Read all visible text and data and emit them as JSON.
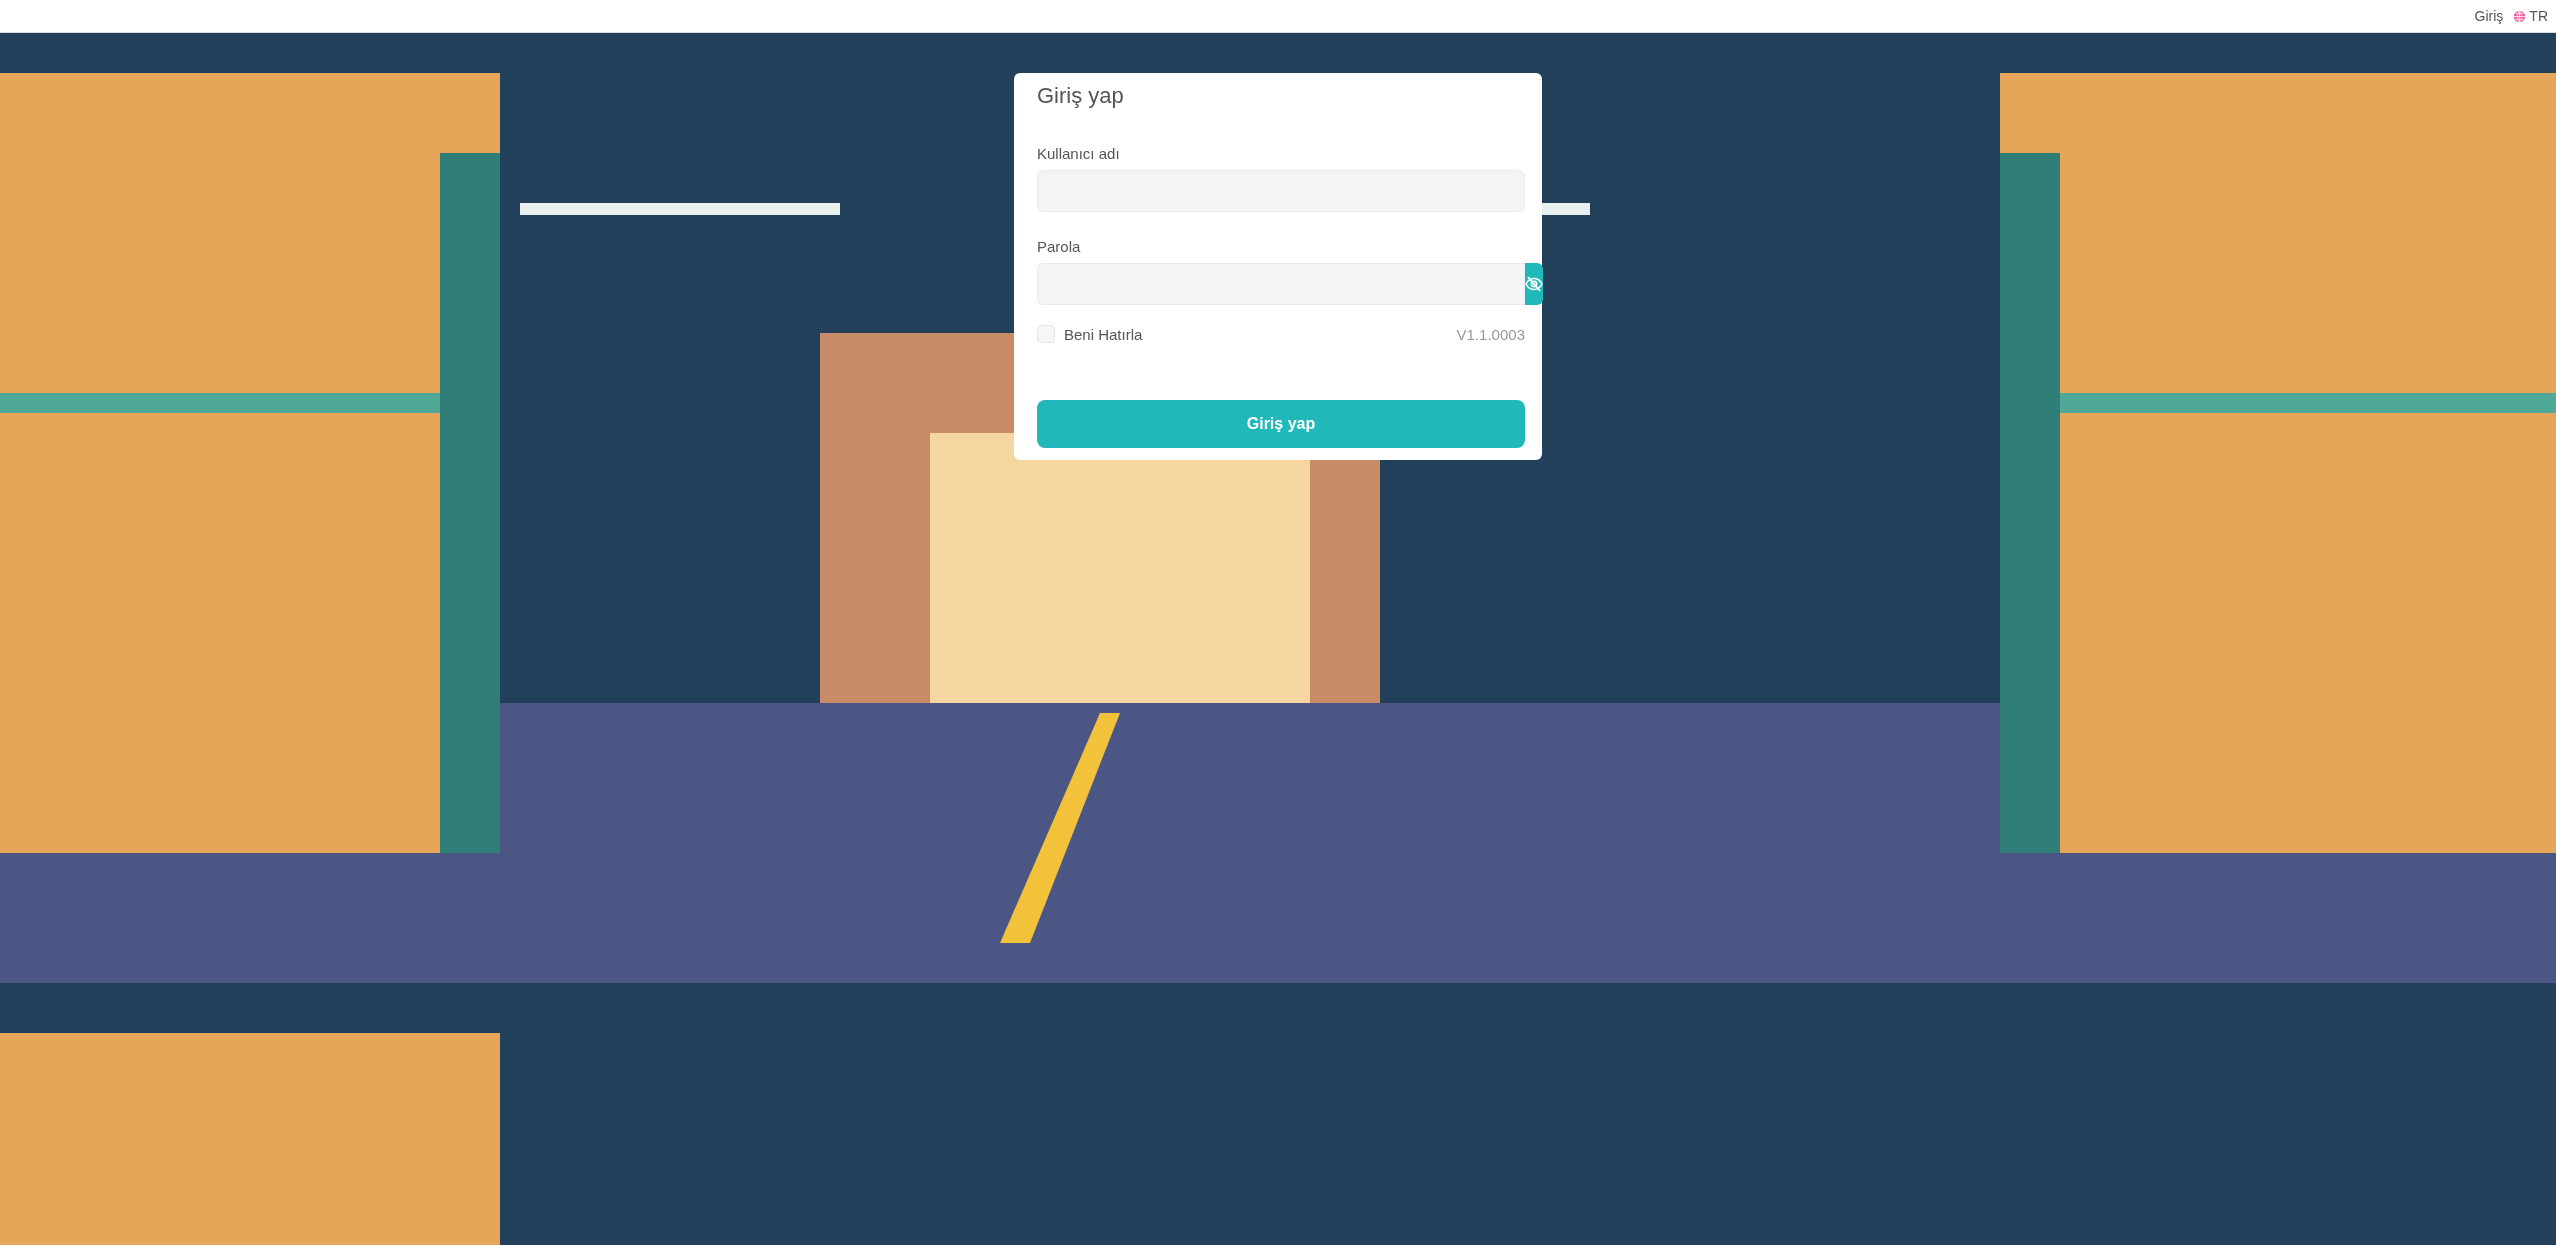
{
  "top_bar": {
    "login_link": "Giriş",
    "language": "TR"
  },
  "login_card": {
    "title": "Giriş yap",
    "fields": [
      {
        "kind": "text",
        "label": "Kullanıcı adı"
      },
      {
        "kind": "password",
        "label": "Parola"
      }
    ],
    "remember_me": {
      "label": "Beni Hatırla",
      "checked": false
    },
    "version": "V1.1.0003",
    "submit": "Giriş yap"
  }
}
